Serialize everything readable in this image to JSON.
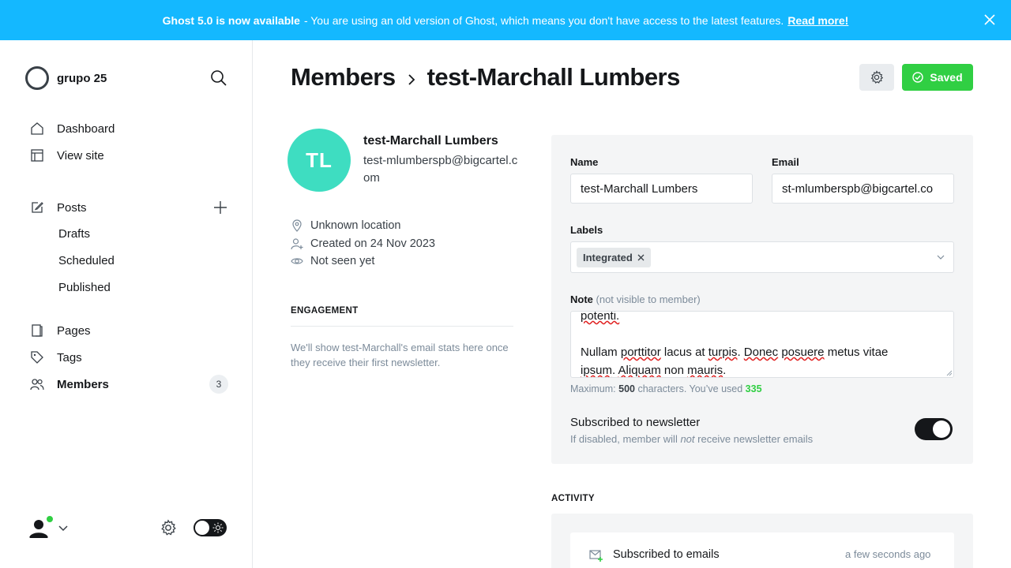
{
  "banner": {
    "headline": "Ghost 5.0 is now available",
    "message": " - You are using an old version of Ghost, which means you don't have access to the latest features.",
    "link": "Read more!"
  },
  "sidebar": {
    "site_name": "grupo 25",
    "items": [
      {
        "label": "Dashboard",
        "icon": "home-icon"
      },
      {
        "label": "View site",
        "icon": "layout-icon"
      },
      {
        "label": "Posts",
        "icon": "edit-icon"
      },
      {
        "label": "Drafts"
      },
      {
        "label": "Scheduled"
      },
      {
        "label": "Published"
      },
      {
        "label": "Pages",
        "icon": "pages-icon"
      },
      {
        "label": "Tags",
        "icon": "tag-icon"
      },
      {
        "label": "Members",
        "icon": "members-icon",
        "count": "3"
      }
    ]
  },
  "header": {
    "section": "Members",
    "title": "test-Marchall Lumbers",
    "saved_label": "Saved"
  },
  "member": {
    "initials": "TL",
    "name": "test-Marchall Lumbers",
    "email": "test-mlumberspb@bigcartel.com",
    "location": "Unknown location",
    "created": "Created on 24 Nov 2023",
    "seen": "Not seen yet"
  },
  "engagement": {
    "title": "ENGAGEMENT",
    "text": "We'll show test-Marchall's email stats here once they receive their first newsletter."
  },
  "form": {
    "name_label": "Name",
    "name_value": "test-Marchall Lumbers",
    "email_label": "Email",
    "email_value": "st-mlumberspb@bigcartel.co",
    "labels_label": "Labels",
    "label_chip": "Integrated",
    "note_label": "Note",
    "note_hint": "(not visible to member)",
    "note_line1": "potenti.",
    "note_line3_a": "Nullam ",
    "note_line3_b": "porttitor",
    "note_line3_c": " lacus at ",
    "note_line3_d": "turpis",
    "note_line3_e": ". ",
    "note_line3_f": "Donec",
    "note_line3_g": " ",
    "note_line3_h": "posuere",
    "note_line3_i": " metus vitae",
    "note_line4_a": "ipsum",
    "note_line4_b": ". ",
    "note_line4_c": "Aliquam",
    "note_line4_d": " non ",
    "note_line4_e": "mauris",
    "note_line4_f": ".",
    "max_prefix": "Maximum: ",
    "max_value": "500",
    "max_middle": " characters. You’ve used ",
    "used_value": "335",
    "newsletter_title": "Subscribed to newsletter",
    "newsletter_desc_a": "If disabled, member will ",
    "newsletter_desc_em": "not",
    "newsletter_desc_b": " receive newsletter emails",
    "newsletter_on": true
  },
  "activity": {
    "title": "ACTIVITY",
    "items": [
      {
        "text": "Subscribed to emails",
        "time": "a few seconds ago",
        "icon": "mail-plus-icon"
      }
    ]
  },
  "colors": {
    "banner": "#14b8ff",
    "accent_green": "#30cf43",
    "avatar": "#3eddc1"
  }
}
